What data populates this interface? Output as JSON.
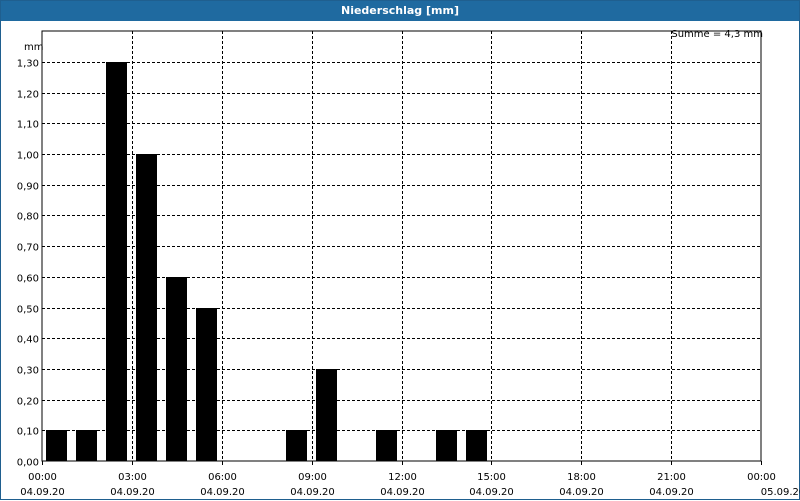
{
  "window": {
    "title": "Niederschlag [mm]"
  },
  "chart_data": {
    "type": "bar",
    "title": "Niederschlag [mm]",
    "ylabel": "mm",
    "annotation": "Summe = 4,3 mm",
    "ylim": [
      0,
      1.3
    ],
    "y_ticks": [
      "0,00",
      "0,10",
      "0,20",
      "0,30",
      "0,40",
      "0,50",
      "0,60",
      "0,70",
      "0,80",
      "0,90",
      "1,00",
      "1,10",
      "1,20",
      "1,30"
    ],
    "x_range_hours": [
      0,
      24
    ],
    "x_ticks": [
      {
        "time": "00:00",
        "date": "04.09.20"
      },
      {
        "time": "03:00",
        "date": "04.09.20"
      },
      {
        "time": "06:00",
        "date": "04.09.20"
      },
      {
        "time": "09:00",
        "date": "04.09.20"
      },
      {
        "time": "12:00",
        "date": "04.09.20"
      },
      {
        "time": "15:00",
        "date": "04.09.20"
      },
      {
        "time": "18:00",
        "date": "04.09.20"
      },
      {
        "time": "21:00",
        "date": "04.09.20"
      },
      {
        "time": "00:00",
        "date": "05.09.20"
      }
    ],
    "grid": true,
    "bar_color": "#000000",
    "series": [
      {
        "x": [
          "01:00",
          "02:00",
          "03:00",
          "04:00",
          "05:00",
          "06:00",
          "07:00",
          "08:00",
          "09:00",
          "10:00",
          "11:00",
          "12:00",
          "13:00",
          "14:00",
          "15:00"
        ],
        "values": [
          0.1,
          0.1,
          1.3,
          1.0,
          0.6,
          0.5,
          0,
          0,
          0.1,
          0.3,
          0,
          0.1,
          0,
          0.1,
          0.1
        ]
      }
    ]
  }
}
